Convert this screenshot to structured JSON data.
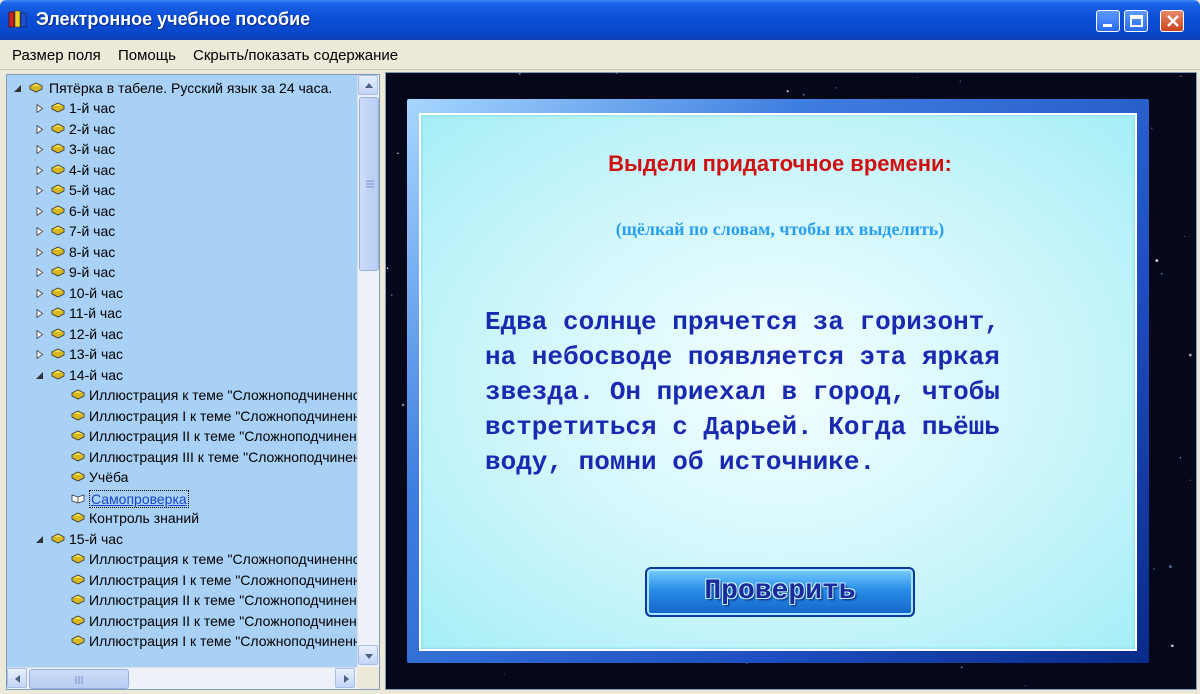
{
  "window": {
    "title": "Электронное учебное пособие"
  },
  "menu": {
    "items": [
      "Размер поля",
      "Помощь",
      "Скрыть/показать содержание"
    ]
  },
  "tree": {
    "root": "Пятёрка в табеле. Русский язык за 24 часа.",
    "items": [
      {
        "label": "1-й час",
        "level": 1,
        "state": "collapsed"
      },
      {
        "label": "2-й час",
        "level": 1,
        "state": "collapsed"
      },
      {
        "label": "3-й час",
        "level": 1,
        "state": "collapsed"
      },
      {
        "label": "4-й час",
        "level": 1,
        "state": "collapsed"
      },
      {
        "label": "5-й час",
        "level": 1,
        "state": "collapsed"
      },
      {
        "label": "6-й час",
        "level": 1,
        "state": "collapsed"
      },
      {
        "label": "7-й час",
        "level": 1,
        "state": "collapsed"
      },
      {
        "label": "8-й час",
        "level": 1,
        "state": "collapsed"
      },
      {
        "label": "9-й час",
        "level": 1,
        "state": "collapsed"
      },
      {
        "label": "10-й час",
        "level": 1,
        "state": "collapsed"
      },
      {
        "label": "11-й час",
        "level": 1,
        "state": "collapsed"
      },
      {
        "label": "12-й час",
        "level": 1,
        "state": "collapsed"
      },
      {
        "label": "13-й час",
        "level": 1,
        "state": "collapsed"
      },
      {
        "label": "14-й час",
        "level": 1,
        "state": "expanded"
      },
      {
        "label": "Иллюстрация к теме \"Сложноподчиненное предложение\"",
        "level": 2
      },
      {
        "label": "Иллюстрация I к теме \"Сложноподчиненное предложение\"",
        "level": 2
      },
      {
        "label": "Иллюстрация II к теме \"Сложноподчиненное предложение\"",
        "level": 2
      },
      {
        "label": "Иллюстрация III к теме \"Сложноподчиненное предложение\"",
        "level": 2
      },
      {
        "label": "Учёба",
        "level": 2
      },
      {
        "label": "Самопроверка",
        "level": 2,
        "selected": true
      },
      {
        "label": "Контроль знаний",
        "level": 2
      },
      {
        "label": "15-й час",
        "level": 1,
        "state": "expanded"
      },
      {
        "label": "Иллюстрация к теме \"Сложноподчиненное предложение\"",
        "level": 2
      },
      {
        "label": "Иллюстрация I к теме \"Сложноподчиненное предложение\"",
        "level": 2
      },
      {
        "label": "Иллюстрация II к теме \"Сложноподчиненное предложение\"",
        "level": 2
      },
      {
        "label": "Иллюстрация II к теме \"Сложноподчиненное предложение\"",
        "level": 2
      },
      {
        "label": "Иллюстрация I к теме \"Сложноподчиненное предложение\"",
        "level": 2
      }
    ]
  },
  "exercise": {
    "title": "Выдели придаточное времени:",
    "hint": "(щёлкай по словам, чтобы их выделить)",
    "text_lines": [
      "Едва солнце прячется за горизонт,",
      "на небосводе появляется эта яркая",
      "звезда. Он приехал в город, чтобы",
      "встретиться с Дарьей. Когда пьёшь",
      "воду, помни об источнике."
    ],
    "check_button": "Проверить"
  },
  "colors": {
    "titlebar": "#0a48cc",
    "tree_bg": "#a9d0f5",
    "title_red": "#d01010",
    "hint_blue": "#2a9ff0",
    "text_blue": "#1a2ab0",
    "space_bg": "#05071a"
  }
}
